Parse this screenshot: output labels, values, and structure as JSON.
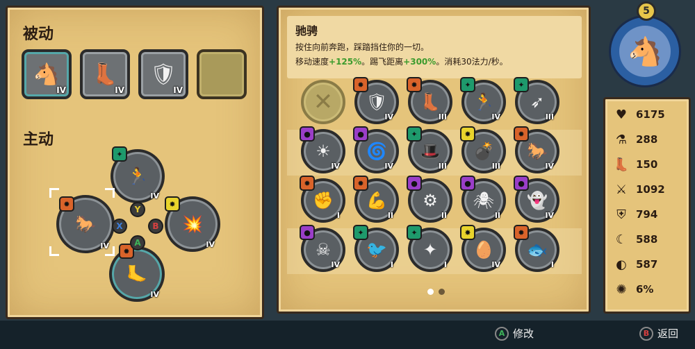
{
  "left_panel": {
    "passive_title": "被动",
    "active_title": "主动",
    "passive": [
      {
        "icon": "sprint-horse-icon",
        "rank": "IV",
        "selected": true
      },
      {
        "icon": "winged-boot-icon",
        "rank": "IV",
        "selected": false
      },
      {
        "icon": "potion-shield-icon",
        "rank": "IV",
        "selected": false
      },
      {
        "icon": "empty-slot-icon",
        "rank": "",
        "selected": false
      }
    ],
    "active": {
      "top": {
        "icon": "dash-run-icon",
        "rank": "IV",
        "badge": "green"
      },
      "left": {
        "icon": "charge-horse-icon",
        "rank": "IV",
        "badge": "orange"
      },
      "right": {
        "icon": "explosion-icon",
        "rank": "IV",
        "badge": "yellow"
      },
      "bottom": {
        "icon": "leap-kick-icon",
        "rank": "IV",
        "badge": "orange"
      }
    },
    "buttons": {
      "y": "Y",
      "x": "X",
      "b": "B",
      "a": "A"
    }
  },
  "skill": {
    "title": "驰骋",
    "line1": "按住向前奔跑，踩踏挡住你的一切。",
    "line2_prefix": "移动速度",
    "speed": "+125%",
    "line2_mid": "。踢飞距离",
    "kick": "+300%",
    "line2_suffix": "。消耗30法力/秒。"
  },
  "grid": [
    [
      {
        "icon": "cancel-icon",
        "rank": "",
        "badge": ""
      },
      {
        "icon": "shield-bash-icon",
        "rank": "IV",
        "badge": "orange"
      },
      {
        "icon": "winged-boot-icon",
        "rank": "III",
        "badge": "orange"
      },
      {
        "icon": "dash-run-icon",
        "rank": "IV",
        "badge": "green"
      },
      {
        "icon": "arrow-volley-icon",
        "rank": "III",
        "badge": "green"
      }
    ],
    [
      {
        "icon": "burst-face-icon",
        "rank": "IV",
        "badge": "purple"
      },
      {
        "icon": "vortex-icon",
        "rank": "IV",
        "badge": "purple"
      },
      {
        "icon": "magic-hat-icon",
        "rank": "III",
        "badge": "green"
      },
      {
        "icon": "bomb-icon",
        "rank": "III",
        "badge": "yellow"
      },
      {
        "icon": "charge-horse-icon",
        "rank": "IV",
        "badge": "orange"
      }
    ],
    [
      {
        "icon": "fist-icon",
        "rank": "I",
        "badge": "orange"
      },
      {
        "icon": "muscle-icon",
        "rank": "II",
        "badge": "orange"
      },
      {
        "icon": "summon-circle-icon",
        "rank": "II",
        "badge": "purple"
      },
      {
        "icon": "spider-icon",
        "rank": "II",
        "badge": "purple"
      },
      {
        "icon": "ghost-icon",
        "rank": "IV",
        "badge": "purple"
      }
    ],
    [
      {
        "icon": "zombie-icon",
        "rank": "IV",
        "badge": "purple"
      },
      {
        "icon": "bird-icon",
        "rank": "I",
        "badge": "green"
      },
      {
        "icon": "shuriken-icon",
        "rank": "I",
        "badge": "green"
      },
      {
        "icon": "egg-icon",
        "rank": "IV",
        "badge": "yellow"
      },
      {
        "icon": "fish-scale-icon",
        "rank": "I",
        "badge": "orange"
      }
    ]
  ],
  "pagination": {
    "current": 1,
    "total": 2
  },
  "hero": {
    "level": "5",
    "portrait": "horse-portrait-icon"
  },
  "stats": [
    {
      "icon": "heart-icon",
      "value": "6175"
    },
    {
      "icon": "potion-icon",
      "value": "288"
    },
    {
      "icon": "boot-icon",
      "value": "150"
    },
    {
      "icon": "crossed-swords-icon",
      "value": "1092"
    },
    {
      "icon": "shield-icon",
      "value": "794"
    },
    {
      "icon": "moon-icon",
      "value": "588"
    },
    {
      "icon": "shield-moon-icon",
      "value": "587"
    },
    {
      "icon": "burst-icon",
      "value": "6%"
    }
  ],
  "controls": {
    "edit_key": "A",
    "edit_label": "修改",
    "back_key": "B",
    "back_label": "返回"
  },
  "colors": {
    "orange": "#d9632a",
    "green": "#1e9a6c",
    "purple": "#9a3ec8",
    "yellow": "#e8d32c"
  }
}
